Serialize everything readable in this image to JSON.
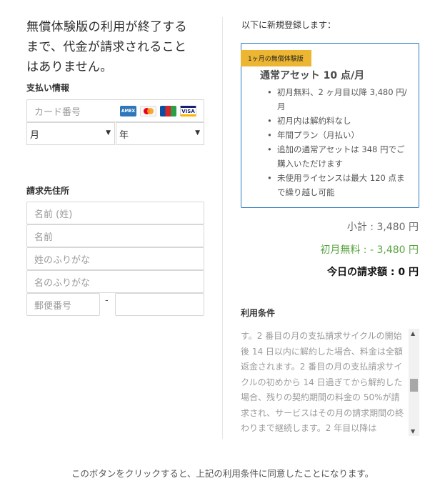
{
  "left": {
    "headline": "無償体験版の利用が終了するまで、代金が請求されることはありません。",
    "payment_label": "支払い情報",
    "card_placeholder": "カード番号",
    "card_icons": [
      "amex-icon",
      "mastercard-icon",
      "jcb-icon",
      "visa-icon"
    ],
    "card_icon_text": {
      "amex": "AMEX",
      "visa": "VISA"
    },
    "month_value": "月",
    "year_value": "年",
    "billing_label": "請求先住所",
    "last_name_placeholder": "名前 (姓)",
    "first_name_placeholder": "名前",
    "last_kana_placeholder": "姓のふりがな",
    "first_kana_placeholder": "名のふりがな",
    "postal_placeholder": "郵便番号",
    "postal_separator": "-"
  },
  "right": {
    "register_title": "以下に新規登録します：",
    "plan": {
      "badge": "1ヶ月の無償体験版",
      "name": "通常アセット 10 点/月",
      "features": [
        "初月無料、2 ヶ月目以降 3,480 円/月",
        "初月内は解約料なし",
        "年間プラン（月払い）",
        "追加の通常アセットは 348 円でご購入いただけます",
        "未使用ライセンスは最大 120 点まで繰り越し可能"
      ]
    },
    "subtotal": "小計 : 3,480 円",
    "discount": "初月無料 : - 3,480 円",
    "today": "今日の請求額 : 0 円",
    "terms_label": "利用条件",
    "terms_text": "す。2 番目の月の支払請求サイクルの開始後 14 日以内に解約した場合、料金は全額返金されます。2 番目の月の支払請求サイクルの初めから 14 日過ぎてから解約した場合、残りの契約期間の料金の 50%が請求され、サービスはその月の請求期間の終わりまで継続します。2 年目以降は"
  },
  "footer": "このボタンをクリックすると、上記の利用条件に同意したことになります。",
  "colors": {
    "accent_blue": "#2d7bbf",
    "badge_yellow": "#ecb632",
    "discount_green": "#5aa542"
  }
}
